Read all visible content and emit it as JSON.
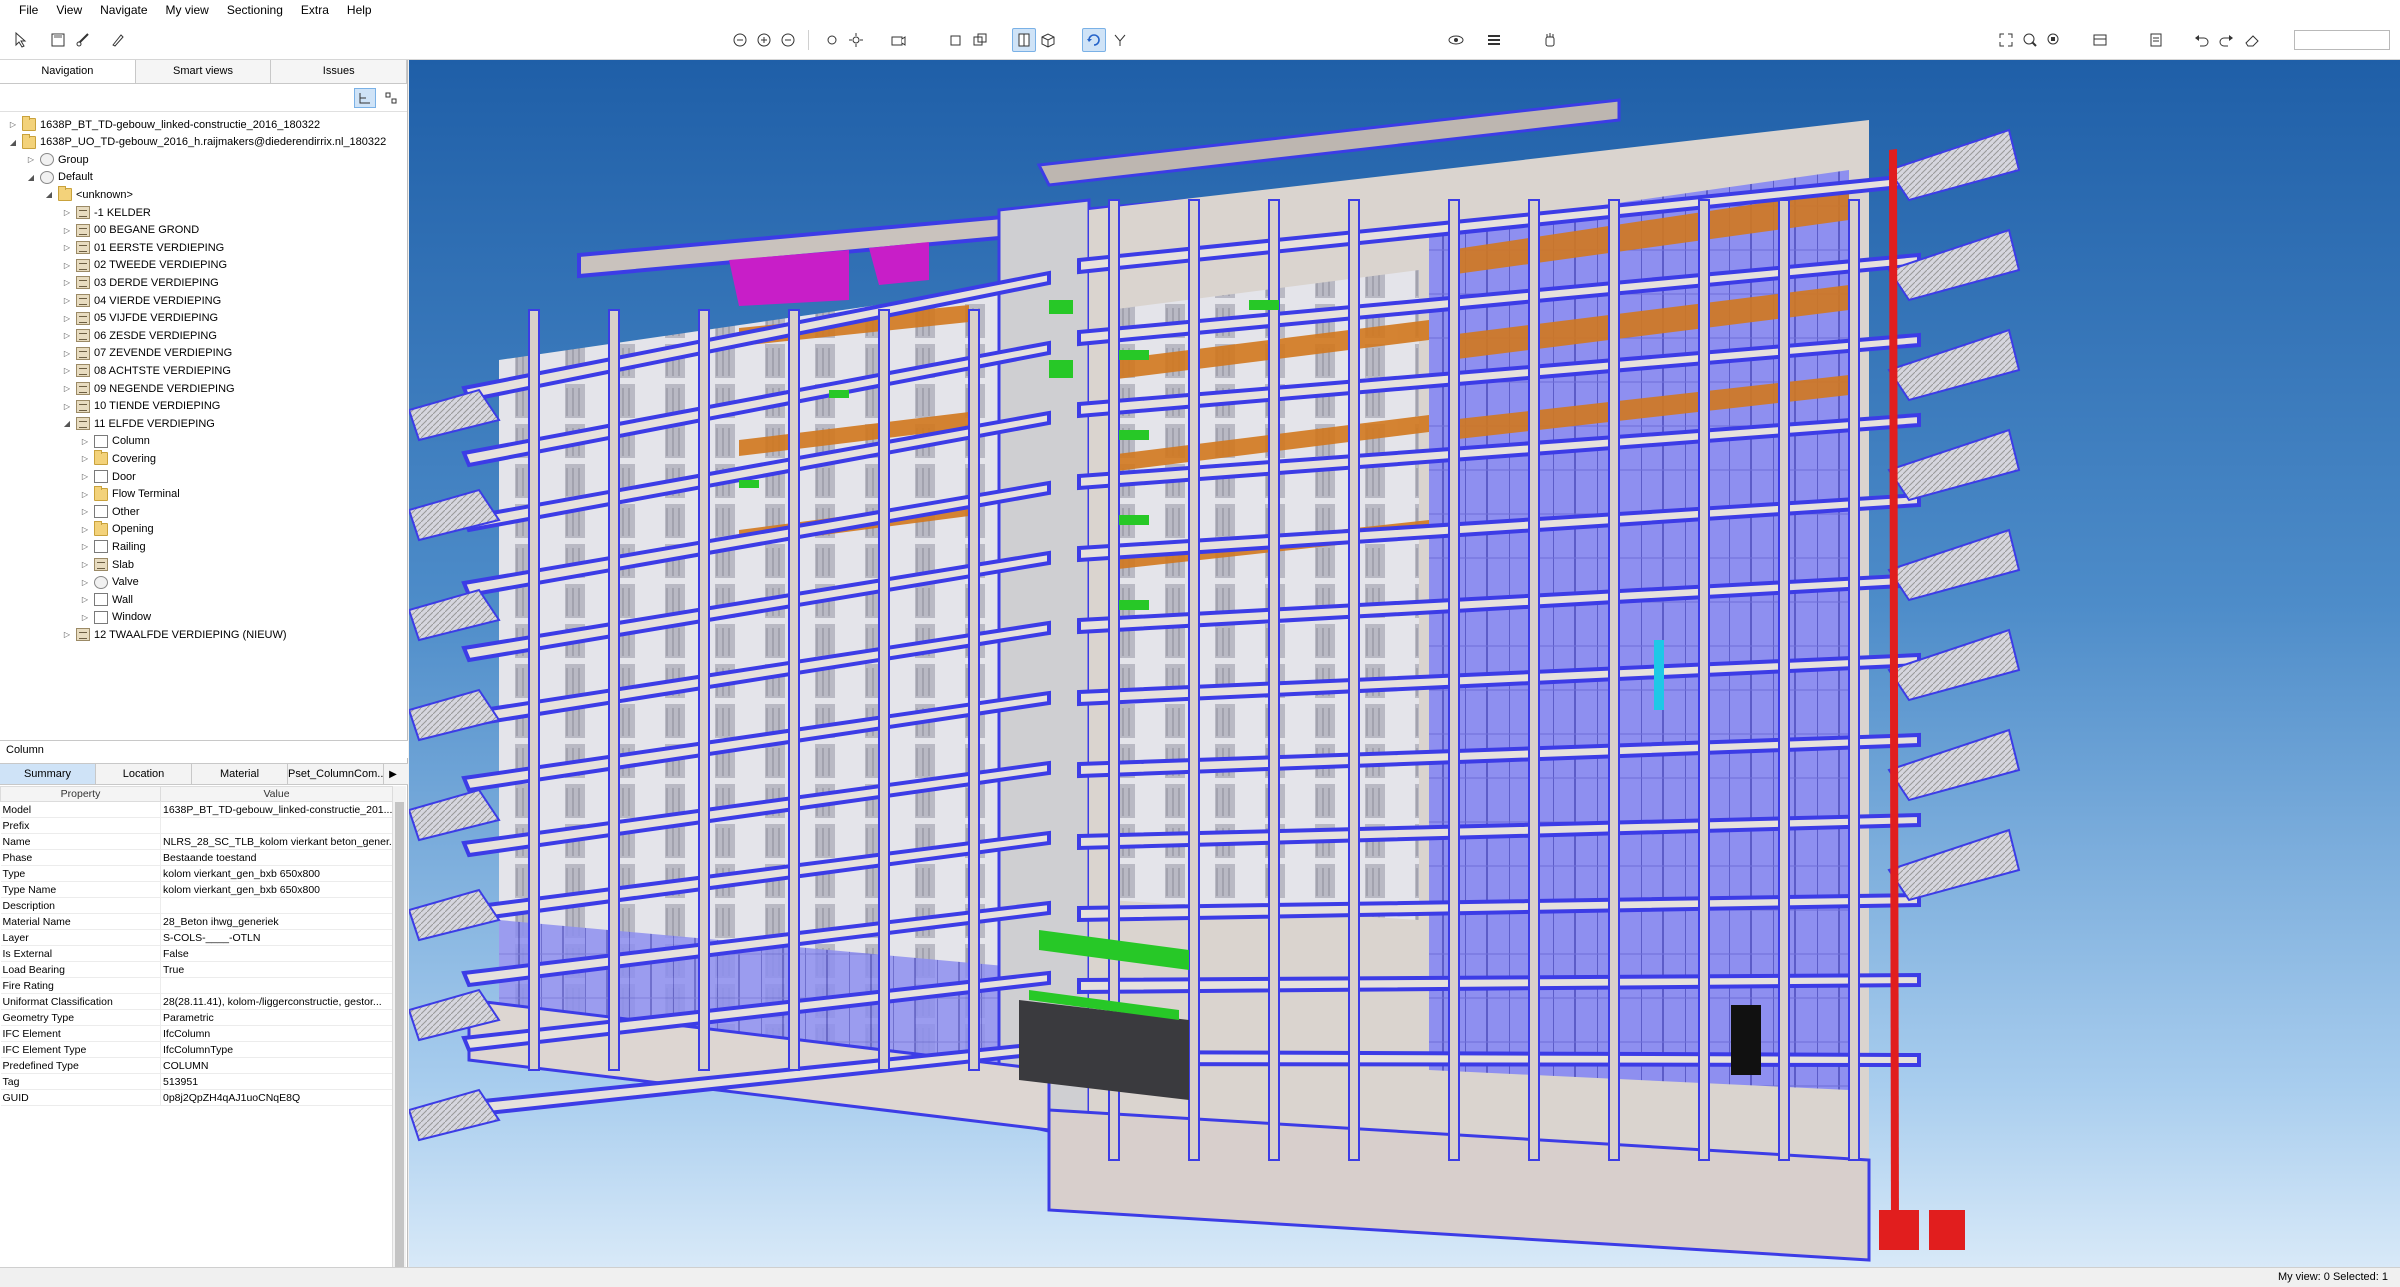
{
  "menu": [
    "File",
    "View",
    "Navigate",
    "My view",
    "Sectioning",
    "Extra",
    "Help"
  ],
  "nav_tabs": [
    "Navigation",
    "Smart views",
    "Issues"
  ],
  "tree": [
    {
      "label": "1638P_BT_TD-gebouw_linked-constructie_2016_180322",
      "level": 0,
      "icon": "folder",
      "caret": "closed"
    },
    {
      "label": "1638P_UO_TD-gebouw_2016_h.raijmakers@diederendirrix.nl_180322",
      "level": 0,
      "icon": "folder",
      "caret": "open"
    },
    {
      "label": "Group",
      "level": 1,
      "icon": "bldg",
      "caret": "closed"
    },
    {
      "label": "Default",
      "level": 1,
      "icon": "bldg",
      "caret": "open"
    },
    {
      "label": "<unknown>",
      "level": 2,
      "icon": "folder",
      "caret": "open"
    },
    {
      "label": "-1 KELDER",
      "level": 3,
      "icon": "storey",
      "caret": "closed"
    },
    {
      "label": "00 BEGANE GROND",
      "level": 3,
      "icon": "storey",
      "caret": "closed"
    },
    {
      "label": "01 EERSTE VERDIEPING",
      "level": 3,
      "icon": "storey",
      "caret": "closed"
    },
    {
      "label": "02 TWEEDE VERDIEPING",
      "level": 3,
      "icon": "storey",
      "caret": "closed"
    },
    {
      "label": "03 DERDE VERDIEPING",
      "level": 3,
      "icon": "storey",
      "caret": "closed"
    },
    {
      "label": "04 VIERDE VERDIEPING",
      "level": 3,
      "icon": "storey",
      "caret": "closed"
    },
    {
      "label": "05 VIJFDE VERDIEPING",
      "level": 3,
      "icon": "storey",
      "caret": "closed"
    },
    {
      "label": "06 ZESDE VERDIEPING",
      "level": 3,
      "icon": "storey",
      "caret": "closed"
    },
    {
      "label": "07 ZEVENDE VERDIEPING",
      "level": 3,
      "icon": "storey",
      "caret": "closed"
    },
    {
      "label": "08 ACHTSTE VERDIEPING",
      "level": 3,
      "icon": "storey",
      "caret": "closed"
    },
    {
      "label": "09 NEGENDE VERDIEPING",
      "level": 3,
      "icon": "storey",
      "caret": "closed"
    },
    {
      "label": "10 TIENDE VERDIEPING",
      "level": 3,
      "icon": "storey",
      "caret": "closed"
    },
    {
      "label": "11 ELFDE VERDIEPING",
      "level": 3,
      "icon": "storey",
      "caret": "open"
    },
    {
      "label": "Column",
      "level": 4,
      "icon": "typ",
      "caret": "closed"
    },
    {
      "label": "Covering",
      "level": 4,
      "icon": "folder",
      "caret": "closed"
    },
    {
      "label": "Door",
      "level": 4,
      "icon": "typ",
      "caret": "closed"
    },
    {
      "label": "Flow Terminal",
      "level": 4,
      "icon": "folder",
      "caret": "closed"
    },
    {
      "label": "Other",
      "level": 4,
      "icon": "typ",
      "caret": "closed"
    },
    {
      "label": "Opening",
      "level": 4,
      "icon": "folder",
      "caret": "closed"
    },
    {
      "label": "Railing",
      "level": 4,
      "icon": "typ",
      "caret": "closed"
    },
    {
      "label": "Slab",
      "level": 4,
      "icon": "storey",
      "caret": "closed"
    },
    {
      "label": "Valve",
      "level": 4,
      "icon": "bldg",
      "caret": "closed"
    },
    {
      "label": "Wall",
      "level": 4,
      "icon": "typ",
      "caret": "closed"
    },
    {
      "label": "Window",
      "level": 4,
      "icon": "typ",
      "caret": "closed"
    },
    {
      "label": "12 TWAALFDE VERDIEPING (NIEUW)",
      "level": 3,
      "icon": "storey",
      "caret": "closed"
    }
  ],
  "properties": {
    "title": "Column",
    "tabs": [
      "Summary",
      "Location",
      "Material",
      "Pset_ColumnCom..."
    ],
    "header": {
      "property": "Property",
      "value": "Value"
    },
    "rows": [
      {
        "property": "Model",
        "value": "1638P_BT_TD-gebouw_linked-constructie_201..."
      },
      {
        "property": "Prefix",
        "value": ""
      },
      {
        "property": "Name",
        "value": "NLRS_28_SC_TLB_kolom vierkant beton_gener..."
      },
      {
        "property": "Phase",
        "value": "Bestaande toestand"
      },
      {
        "property": "Type",
        "value": "kolom vierkant_gen_bxb 650x800"
      },
      {
        "property": "Type Name",
        "value": "kolom vierkant_gen_bxb 650x800"
      },
      {
        "property": "Description",
        "value": ""
      },
      {
        "property": "Material Name",
        "value": "28_Beton ihwg_generiek"
      },
      {
        "property": "Layer",
        "value": "S-COLS-____-OTLN"
      },
      {
        "property": "Is External",
        "value": "False"
      },
      {
        "property": "Load Bearing",
        "value": "True"
      },
      {
        "property": "Fire Rating",
        "value": ""
      },
      {
        "property": "Uniformat Classification",
        "value": "28(28.11.41), kolom-/liggerconstructie, gestor..."
      },
      {
        "property": "Geometry Type",
        "value": "Parametric"
      },
      {
        "property": "IFC Element",
        "value": "IfcColumn"
      },
      {
        "property": "IFC Element Type",
        "value": "IfcColumnType"
      },
      {
        "property": "Predefined Type",
        "value": "COLUMN"
      },
      {
        "property": "Tag",
        "value": "513951"
      },
      {
        "property": "GUID",
        "value": "0p8j2QpZH4qAJ1uoCNqE8Q"
      }
    ]
  },
  "status": "My view: 0   Selected: 1",
  "colors": {
    "sky_top": "#1f5fa8",
    "section_edge": "#3c3ce6",
    "glazing": "#8c8cf0",
    "ceiling": "#d2781e",
    "highlight_green": "#27c827",
    "selected_red": "#e11e1e",
    "roof_magenta": "#c81ec8"
  }
}
